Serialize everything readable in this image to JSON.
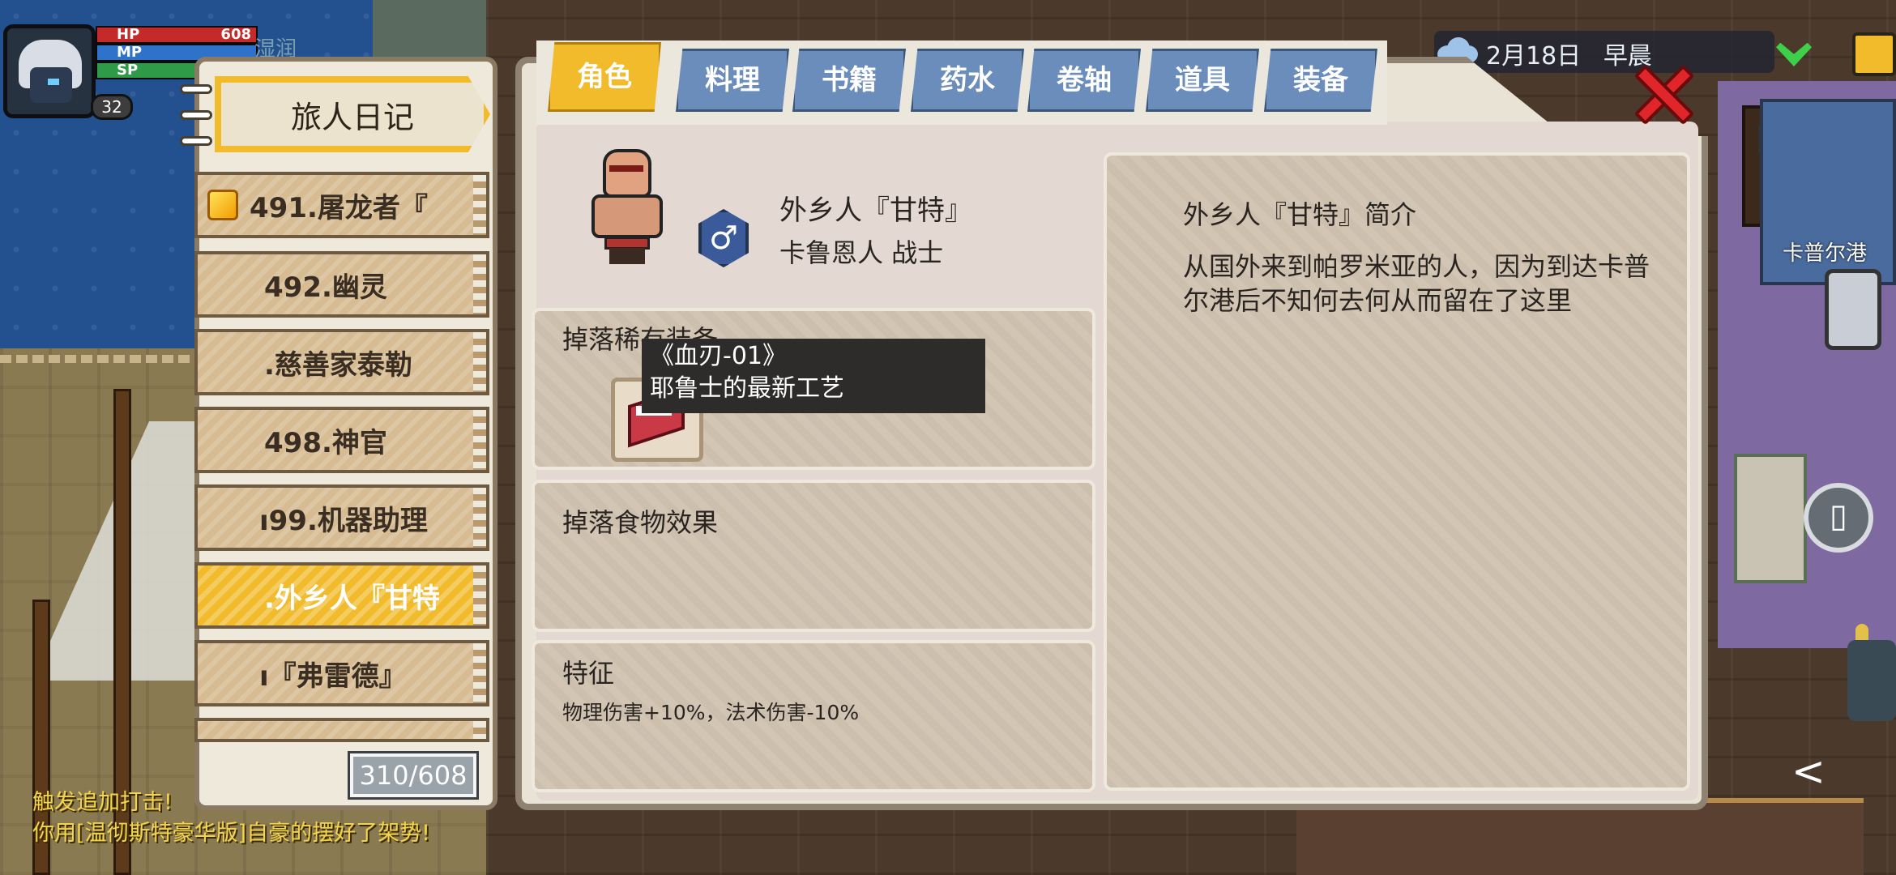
{
  "player": {
    "hp_label": "HP",
    "hp_value": "608",
    "mp_label": "MP",
    "mp_value": "",
    "sp_label": "SP",
    "sp_value": "",
    "level": "32",
    "status_tag": "湿润"
  },
  "journal": {
    "title": "旅人日记",
    "entries": [
      {
        "label": "491.屠龙者『",
        "active": false
      },
      {
        "label": "492.幽灵",
        "active": false
      },
      {
        "label": ".慈善家泰勒",
        "active": false
      },
      {
        "label": "498.神官",
        "active": false
      },
      {
        "label": "ı99.机器助理",
        "active": false
      },
      {
        "label": ".外乡人『甘特",
        "active": true
      },
      {
        "label": "ı『弗雷德』",
        "active": false
      }
    ],
    "counter": "310/608"
  },
  "tabs": [
    "角色",
    "料理",
    "书籍",
    "药水",
    "卷轴",
    "道具",
    "装备"
  ],
  "active_tab": "角色",
  "character": {
    "name": "外乡人『甘特』",
    "subtitle": "卡鲁恩人 战士",
    "gender_icon": "male-icon"
  },
  "sections": {
    "drop_rare_title": "掉落稀有装备",
    "drop_food_title": "掉落食物效果",
    "traits_title": "特征",
    "traits_desc": "物理伤害+10%，法术伤害-10%"
  },
  "tooltip": {
    "line1": "《血刃-01》",
    "line2": "耶鲁士的最新工艺"
  },
  "description": {
    "title": "外乡人『甘特』简介",
    "body": "从国外来到帕罗米亚的人，因为到达卡普尔港后不知何去何从而留在了这里"
  },
  "hud": {
    "date": "2月18日",
    "time_of_day": "早晨",
    "location": "卡普尔港"
  },
  "log": [
    "触发追加打击!",
    "你用[温彻斯特豪华版]自豪的摆好了架势!"
  ],
  "colors": {
    "accent": "#f1bb2c",
    "tab": "#6b8dbb",
    "close": "#e0262a"
  }
}
